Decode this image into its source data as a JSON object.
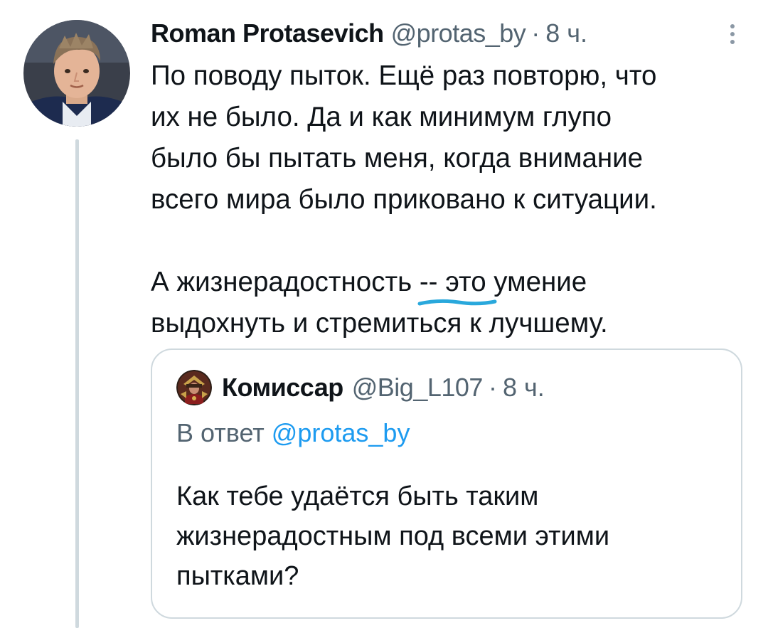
{
  "tweet": {
    "author": {
      "display_name": "Roman Protasevich",
      "handle": "@protas_by",
      "avatar_icon": "profile-photo"
    },
    "separator": "·",
    "time": "8 ч.",
    "text_lines_p1": [
      "По поводу пыток. Ещё раз повторю, что",
      "их не было. Да и как минимум глупо",
      "было бы пытать меня, когда внимание",
      "всего мира было приковано к ситуации."
    ],
    "text_lines_p2": [
      "А жизнерадостность -- это умение",
      "выдохнуть и стремиться к лучшему."
    ],
    "more_icon": "more-vertical-icon"
  },
  "quoted": {
    "author": {
      "display_name": "Комиссар",
      "handle": "@Big_L107",
      "avatar_icon": "commissar-avatar"
    },
    "separator": "·",
    "time": "8 ч.",
    "reply_prefix": "В ответ",
    "reply_mention": "@protas_by",
    "text_lines": [
      "Как тебе удаётся быть таким",
      "жизнерадостным под всеми этими",
      "пытками?"
    ]
  },
  "colors": {
    "text_primary": "#0f1419",
    "text_secondary": "#536471",
    "link": "#1d9bf0",
    "border": "#cfd9de",
    "highlight_underline": "#29a8dc"
  }
}
